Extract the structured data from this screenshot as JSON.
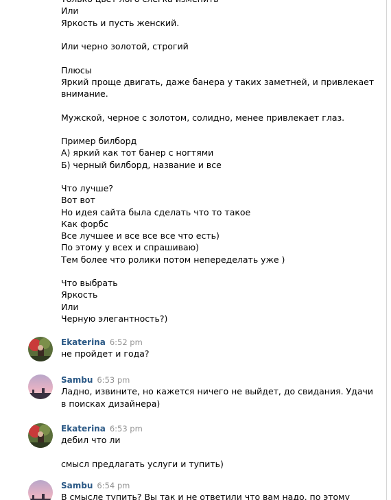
{
  "intro_lines": [
    "Только цвет лого слегка изменить",
    "Или",
    "Яркость и пусть женский.",
    "",
    "Или черно золотой, строгий",
    "",
    "Плюсы",
    "Яркий проще двигать, даже банера у таких заметней, и привлекает",
    "внимание.",
    "",
    "Мужской, черное с золотом, солидно, менее привлекает глаз.",
    "",
    "Пример билборд",
    "А) яркий как тот банер с ногтями",
    "Б) черный билборд, название и все",
    "",
    "Что лучше?",
    "Вот вот",
    "Но идея сайта была сделать что то такое",
    "Как форбс",
    "Все лучшее и все все все что есть)",
    "По этому у всех и спрашиваю)",
    "Тем более что ролики потом непеределать уже )",
    "",
    "Что выбрать",
    "Яркость",
    "Или",
    "Черную элегантность?)"
  ],
  "messages": [
    {
      "author": "Ekaterina",
      "time": "6:52 pm",
      "avatar": "avatar-ekaterina",
      "lines": [
        "не пройдет и года?"
      ]
    },
    {
      "author": "Sambu",
      "time": "6:53 pm",
      "avatar": "avatar-sambu",
      "lines": [
        "Ладно, извините, но кажется ничего не выйдет, до свидания. Удачи",
        "в поисках дизайнера)"
      ]
    },
    {
      "author": "Ekaterina",
      "time": "6:53 pm",
      "avatar": "avatar-ekaterina",
      "lines": [
        "дебил что ли",
        "",
        "смысл предлагать услуги и тупить)"
      ]
    },
    {
      "author": "Sambu",
      "time": "6:54 pm",
      "avatar": "avatar-sambu",
      "lines": [
        "В смысле тупить? Вы так и не ответили что вам надо, по этому"
      ]
    }
  ],
  "colors": {
    "author_link": "#2a5885",
    "timestamp": "#939393",
    "text": "#000000"
  }
}
